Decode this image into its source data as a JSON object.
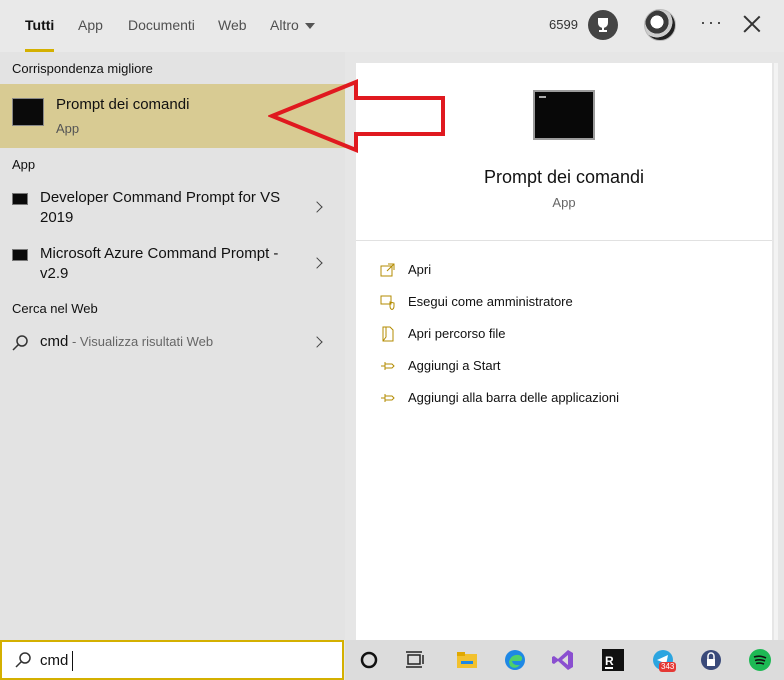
{
  "tabs": [
    {
      "label": "Tutti"
    },
    {
      "label": "App"
    },
    {
      "label": "Documenti"
    },
    {
      "label": "Web"
    },
    {
      "label": "Altro"
    }
  ],
  "header": {
    "points": "6599"
  },
  "left": {
    "best_match_heading": "Corrispondenza migliore",
    "best_match": {
      "title": "Prompt dei comandi",
      "subtitle": "App"
    },
    "apps_heading": "App",
    "apps": [
      {
        "label": "Developer Command Prompt for VS 2019"
      },
      {
        "label": "Microsoft Azure Command Prompt - v2.9"
      }
    ],
    "web_heading": "Cerca nel Web",
    "web": {
      "query": "cmd",
      "suffix": " - Visualizza risultati Web"
    }
  },
  "preview": {
    "title": "Prompt dei comandi",
    "subtitle": "App",
    "actions": [
      {
        "label": "Apri",
        "icon": "open-icon"
      },
      {
        "label": "Esegui come amministratore",
        "icon": "shield-icon"
      },
      {
        "label": "Apri percorso file",
        "icon": "file-location-icon"
      },
      {
        "label": "Aggiungi a Start",
        "icon": "pin-icon"
      },
      {
        "label": "Aggiungi alla barra delle applicazioni",
        "icon": "pin-icon"
      }
    ]
  },
  "search": {
    "value": "cmd"
  },
  "taskbar": {
    "telegram_badge": "343"
  },
  "colors": {
    "accent": "#d4b000",
    "highlight": "#d8cb93",
    "arrow": "#e0191f"
  }
}
